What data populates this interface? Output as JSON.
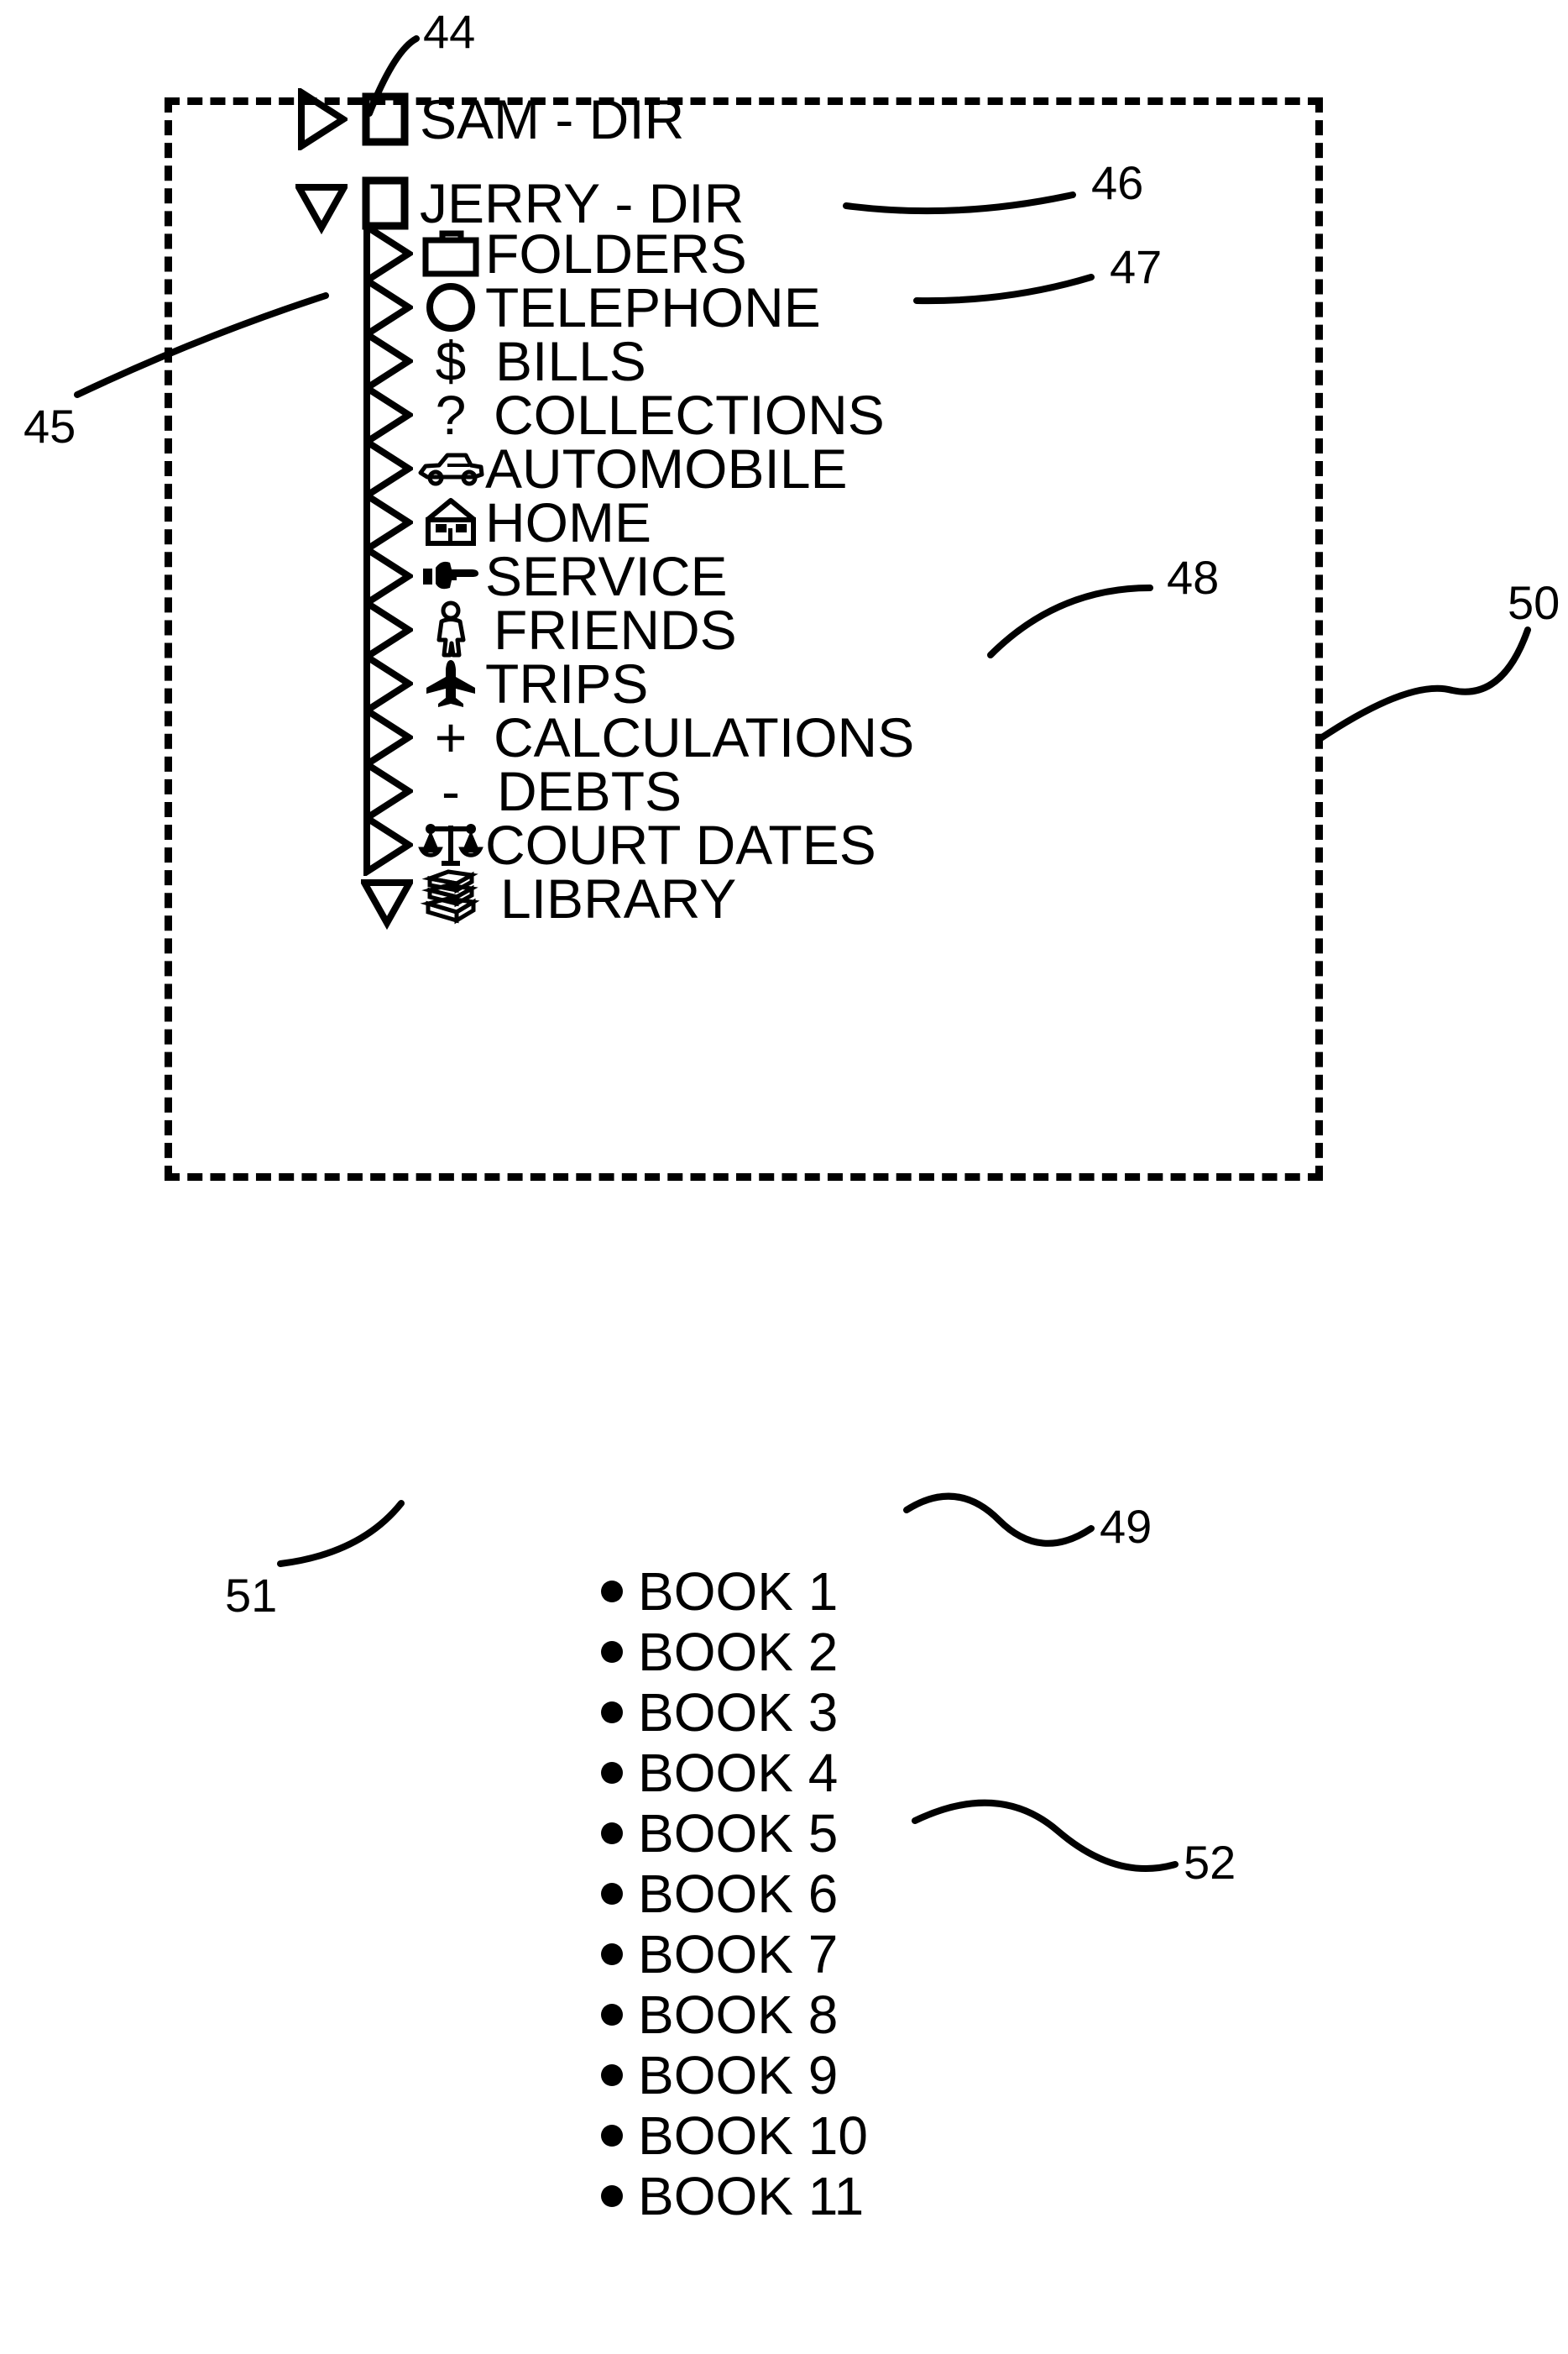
{
  "figure": {
    "background_color": "#ffffff",
    "ink_color": "#000000",
    "boundary": {
      "style": "dashed",
      "ref": "50"
    }
  },
  "tree": {
    "roots": [
      {
        "label": "SAM - DIR",
        "disclosure": "collapsed",
        "icon": "square-icon",
        "indent": 0,
        "ref": "46"
      },
      {
        "label": "JERRY - DIR",
        "disclosure": "expanded",
        "icon": "square-icon",
        "indent": 0,
        "ref": "47"
      }
    ],
    "children": [
      {
        "label": "FOLDERS",
        "disclosure": "collapsed",
        "icon": "briefcase-icon",
        "glyph": ""
      },
      {
        "label": "TELEPHONE",
        "disclosure": "collapsed",
        "icon": "circle-icon",
        "glyph": ""
      },
      {
        "label": "BILLS",
        "disclosure": "collapsed",
        "icon": "dollar-icon",
        "glyph": "$"
      },
      {
        "label": "COLLECTIONS",
        "disclosure": "collapsed",
        "icon": "question-icon",
        "glyph": "?",
        "ref": "48"
      },
      {
        "label": "AUTOMOBILE",
        "disclosure": "collapsed",
        "icon": "car-icon",
        "glyph": ""
      },
      {
        "label": "HOME",
        "disclosure": "collapsed",
        "icon": "house-icon",
        "glyph": ""
      },
      {
        "label": "SERVICE",
        "disclosure": "collapsed",
        "icon": "pointing-hand-icon",
        "glyph": ""
      },
      {
        "label": "FRIENDS",
        "disclosure": "collapsed",
        "icon": "person-icon",
        "glyph": ""
      },
      {
        "label": "TRIPS",
        "disclosure": "collapsed",
        "icon": "airplane-icon",
        "glyph": ""
      },
      {
        "label": "CALCULATIONS",
        "disclosure": "collapsed",
        "icon": "plus-icon",
        "glyph": "+"
      },
      {
        "label": "DEBTS",
        "disclosure": "collapsed",
        "icon": "minus-icon",
        "glyph": "-"
      },
      {
        "label": "COURT DATES",
        "disclosure": "collapsed",
        "icon": "scales-icon",
        "glyph": ""
      },
      {
        "label": "LIBRARY",
        "disclosure": "expanded",
        "icon": "books-icon",
        "glyph": "",
        "ref": "49"
      }
    ],
    "leaves": [
      {
        "label": "BOOK 1"
      },
      {
        "label": "BOOK 2"
      },
      {
        "label": "BOOK 3"
      },
      {
        "label": "BOOK 4",
        "ref": "52"
      },
      {
        "label": "BOOK 5"
      },
      {
        "label": "BOOK 6"
      },
      {
        "label": "BOOK 7"
      },
      {
        "label": "BOOK 8"
      },
      {
        "label": "BOOK 9"
      },
      {
        "label": "BOOK 10"
      },
      {
        "label": "BOOK 11"
      }
    ]
  },
  "reference_numerals": [
    {
      "id": "44",
      "text": "44",
      "points_to": "sam-dir-collapsed-triangle"
    },
    {
      "id": "45",
      "text": "45",
      "points_to": "jerry-dir-expanded-triangle"
    },
    {
      "id": "46",
      "text": "46",
      "points_to": "sam-dir-label"
    },
    {
      "id": "47",
      "text": "47",
      "points_to": "jerry-dir-label"
    },
    {
      "id": "48",
      "text": "48",
      "points_to": "collections-label"
    },
    {
      "id": "49",
      "text": "49",
      "points_to": "library-label"
    },
    {
      "id": "50",
      "text": "50",
      "points_to": "dashed-boundary-box"
    },
    {
      "id": "51",
      "text": "51",
      "points_to": "library-expanded-triangle"
    },
    {
      "id": "52",
      "text": "52",
      "points_to": "book-4-item"
    }
  ]
}
